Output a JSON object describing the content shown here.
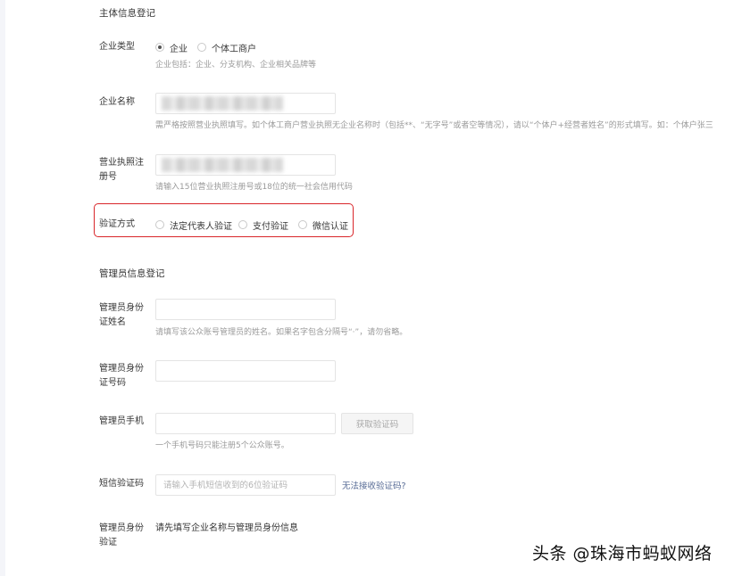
{
  "sections": {
    "entity_title": "主体信息登记",
    "admin_title": "管理员信息登记"
  },
  "entity": {
    "type": {
      "label": "企业类型",
      "options": [
        "企业",
        "个体工商户"
      ],
      "selected": "企业",
      "hint": "企业包括：企业、分支机构、企业相关品牌等"
    },
    "name": {
      "label": "企业名称",
      "hint": "需严格按照营业执照填写。如个体工商户营业执照无企业名称时（包括**、“无字号”或者空等情况），请以“个体户+经营者姓名”的形式填写。如：个体户张三"
    },
    "license": {
      "label_line1": "营业执照注",
      "label_line2": "册号",
      "hint": "请输入15位营业执照注册号或18位的统一社会信用代码"
    },
    "verify": {
      "label": "验证方式",
      "options": [
        "法定代表人验证",
        "支付验证",
        "微信认证"
      ]
    }
  },
  "admin": {
    "id_name": {
      "label_line1": "管理员身份",
      "label_line2": "证姓名",
      "value": "",
      "hint": "请填写该公众账号管理员的姓名。如果名字包含分隔号“·”，请勿省略。"
    },
    "id_number": {
      "label_line1": "管理员身份",
      "label_line2": "证号码",
      "value": ""
    },
    "phone": {
      "label": "管理员手机",
      "value": "",
      "button": "获取验证码",
      "hint": "一个手机号码只能注册5个公众账号。"
    },
    "sms": {
      "label": "短信验证码",
      "placeholder": "请输入手机短信收到的6位验证码",
      "link": "无法接收验证码?"
    },
    "identity": {
      "label_line1": "管理员身份",
      "label_line2": "验证",
      "text": "请先填写企业名称与管理员身份信息"
    }
  },
  "watermark": "头条 @珠海市蚂蚁网络",
  "colors": {
    "highlight": "#d9262a",
    "link": "#576b95",
    "hint": "#9a9a9a"
  }
}
